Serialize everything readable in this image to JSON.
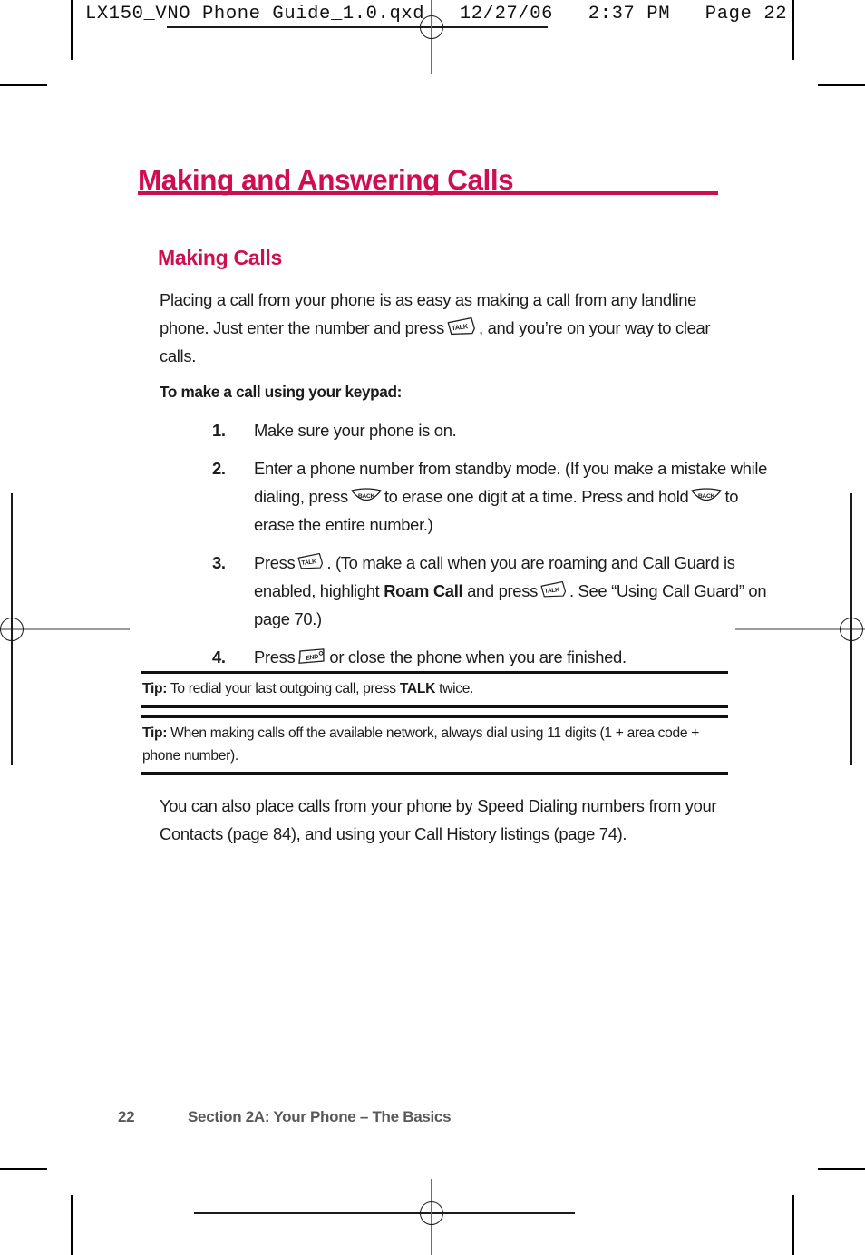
{
  "prepress": {
    "slug": "LX150_VNO Phone Guide_1.0.qxd   12/27/06   2:37 PM   Page 22"
  },
  "colors": {
    "accent": "#CE0E51",
    "body_text": "#1c1c1c",
    "footer_text": "#58595b"
  },
  "chapter": {
    "title": "Making and Answering Calls"
  },
  "section": {
    "title": "Making Calls"
  },
  "intro": {
    "part1": "Placing a call from your phone is as easy as making a call from any landline phone. Just enter the number and press",
    "part2": ", and you’re on your way to clear calls."
  },
  "lead_in": {
    "text": "To make a call using your keypad:"
  },
  "steps": [
    {
      "num": "1.",
      "part1": "Make sure your phone is on.",
      "part2": "",
      "part3": "",
      "part4": ""
    },
    {
      "num": "2.",
      "part1": "Enter a phone number from standby mode. (If you make a mistake while dialing, press",
      "part2": "to erase one digit at a time. Press and hold",
      "part3": "to erase the entire number.)",
      "part4": ""
    },
    {
      "num": "3.",
      "part1": "Press",
      "part2": ". (To make a call when you are roaming and Call Guard is enabled, highlight",
      "part2b": "Roam Call",
      "part3": "and press",
      "part4": ". See “Using Call Guard” on page 70.)"
    },
    {
      "num": "4.",
      "part1": "Press",
      "part2": "or close the phone when you are finished.",
      "part3": "",
      "part4": ""
    }
  ],
  "tips": [
    {
      "label": "Tip:",
      "text_before": "To redial your last outgoing call, press",
      "emphasis": "TALK",
      "text_after": "twice."
    },
    {
      "label": "Tip:",
      "text_before": "When making calls off the available network, always dial using 11 digits (1 + area code + phone number).",
      "emphasis": "",
      "text_after": ""
    }
  ],
  "outro": {
    "text": "You can also place calls from your phone by Speed Dialing numbers from your Contacts (page 84), and using your Call History listings (page 74)."
  },
  "footer": {
    "page_number": "22",
    "section_label": "Section 2A: Your Phone – The Basics"
  },
  "icons": {
    "talk": "TALK",
    "back": "BACK",
    "end": "END"
  }
}
